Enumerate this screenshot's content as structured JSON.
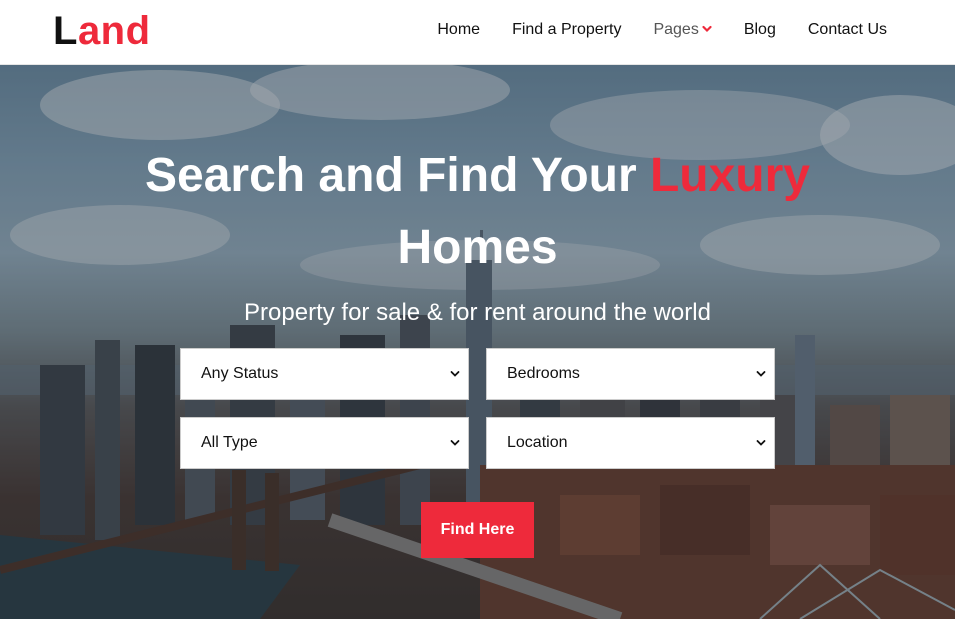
{
  "nav": {
    "logo_first": "L",
    "logo_rest": "and",
    "items": [
      {
        "label": "Home"
      },
      {
        "label": "Find a Property"
      },
      {
        "label": "Pages"
      },
      {
        "label": "Blog"
      },
      {
        "label": "Contact Us"
      }
    ]
  },
  "hero": {
    "headline_part1": "Search and Find Your ",
    "headline_accent": "Luxury",
    "headline_part2": "Homes",
    "subheadline": "Property for sale & for rent around the world",
    "filters": {
      "status": "Any Status",
      "bedrooms": "Bedrooms",
      "type": "All Type",
      "location": "Location"
    },
    "search_button": "Find Here"
  },
  "colors": {
    "accent": "#ee2a3b",
    "text_dark": "#111111",
    "white": "#ffffff"
  },
  "icons": {
    "pages_dropdown": "chevron-down-icon",
    "select_caret": "chevron-down-icon"
  }
}
